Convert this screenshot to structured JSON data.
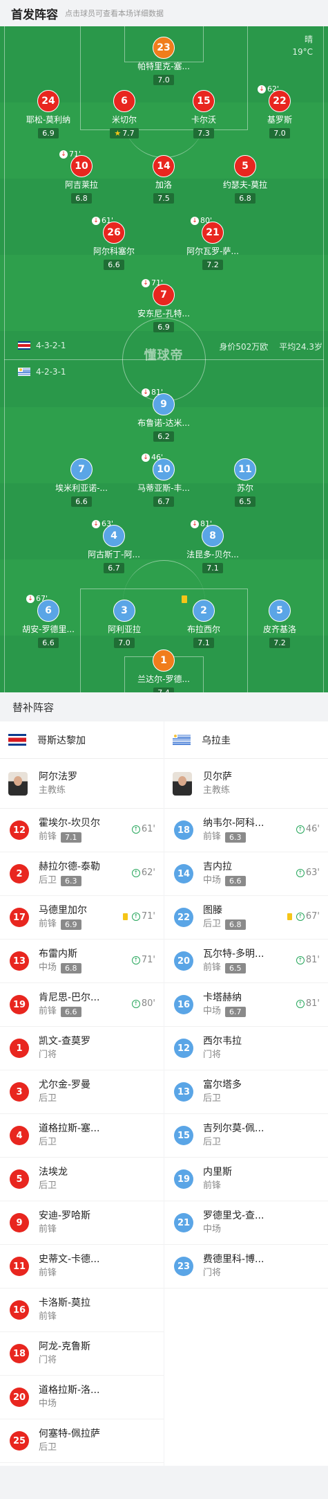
{
  "header": {
    "title": "首发阵容",
    "subtitle": "点击球员可查看本场详细数据"
  },
  "weather": {
    "condition": "晴",
    "temperature": "19°C"
  },
  "pitch": {
    "logo": "懂球帝"
  },
  "home": {
    "formation": "4-3-2-1",
    "value": "身价502万欧",
    "avg_age": "平均24.3岁"
  },
  "away": {
    "formation": "4-2-3-1"
  },
  "home_players": [
    {
      "num": "23",
      "name": "帕特里克-塞...",
      "rating": "7.0",
      "gk": true
    },
    {
      "num": "24",
      "name": "耶松-莫利纳",
      "rating": "6.9"
    },
    {
      "num": "6",
      "name": "米切尔",
      "rating": "7.7",
      "star": true
    },
    {
      "num": "15",
      "name": "卡尔沃",
      "rating": "7.3"
    },
    {
      "num": "22",
      "name": "基罗斯",
      "rating": "7.0",
      "sub": "62'"
    },
    {
      "num": "10",
      "name": "阿吉莱拉",
      "rating": "6.8",
      "sub": "71'"
    },
    {
      "num": "14",
      "name": "加洛",
      "rating": "7.5"
    },
    {
      "num": "5",
      "name": "约瑟夫-莫拉",
      "rating": "6.8"
    },
    {
      "num": "26",
      "name": "阿尔科塞尔",
      "rating": "6.6",
      "sub": "61'"
    },
    {
      "num": "21",
      "name": "阿尔瓦罗-萨...",
      "rating": "7.2",
      "sub": "80'"
    },
    {
      "num": "7",
      "name": "安东尼-孔特...",
      "rating": "6.9",
      "sub": "71'"
    }
  ],
  "away_players": [
    {
      "num": "9",
      "name": "布鲁诺-达米...",
      "rating": "6.2",
      "sub": "81'"
    },
    {
      "num": "7",
      "name": "埃米利亚诺-...",
      "rating": "6.6"
    },
    {
      "num": "10",
      "name": "马蒂亚斯-丰...",
      "rating": "6.7",
      "sub": "46'"
    },
    {
      "num": "11",
      "name": "苏尔",
      "rating": "6.5"
    },
    {
      "num": "4",
      "name": "阿古斯丁-阿...",
      "rating": "6.7",
      "sub": "63'"
    },
    {
      "num": "8",
      "name": "法昆多-贝尔...",
      "rating": "7.1",
      "sub": "81'"
    },
    {
      "num": "6",
      "name": "胡安-罗德里...",
      "rating": "6.6",
      "sub": "67'"
    },
    {
      "num": "3",
      "name": "阿利亚拉",
      "rating": "7.0"
    },
    {
      "num": "2",
      "name": "布拉西尔",
      "rating": "7.1",
      "card": true
    },
    {
      "num": "5",
      "name": "皮齐基洛",
      "rating": "7.2"
    },
    {
      "num": "1",
      "name": "兰达尔-罗德...",
      "rating": "7.4",
      "gk": true
    }
  ],
  "subs_title": "替补阵容",
  "subs_home": {
    "team": "哥斯达黎加",
    "coach": {
      "name": "阿尔法罗",
      "role": "主教练"
    },
    "players": [
      {
        "num": "12",
        "name": "霍埃尔-坎贝尔",
        "pos": "前锋",
        "rating": "7.1",
        "in": "61'"
      },
      {
        "num": "2",
        "name": "赫拉尔德-泰勒",
        "pos": "后卫",
        "rating": "6.3",
        "in": "62'"
      },
      {
        "num": "17",
        "name": "马德里加尔",
        "pos": "前锋",
        "rating": "6.9",
        "in": "71'",
        "card": true
      },
      {
        "num": "13",
        "name": "布雷内斯",
        "pos": "中场",
        "rating": "6.8",
        "in": "71'"
      },
      {
        "num": "19",
        "name": "肯尼思-巴尔...",
        "pos": "前锋",
        "rating": "6.6",
        "in": "80'"
      },
      {
        "num": "1",
        "name": "凯文-查莫罗",
        "pos": "门将"
      },
      {
        "num": "3",
        "name": "尤尔金-罗曼",
        "pos": "后卫"
      },
      {
        "num": "4",
        "name": "道格拉斯-塞...",
        "pos": "后卫"
      },
      {
        "num": "5",
        "name": "法埃龙",
        "pos": "后卫"
      },
      {
        "num": "9",
        "name": "安迪-罗哈斯",
        "pos": "前锋"
      },
      {
        "num": "11",
        "name": "史蒂文-卡德...",
        "pos": "前锋"
      },
      {
        "num": "16",
        "name": "卡洛斯-莫拉",
        "pos": "前锋"
      },
      {
        "num": "18",
        "name": "阿龙-克鲁斯",
        "pos": "门将"
      },
      {
        "num": "20",
        "name": "道格拉斯-洛...",
        "pos": "中场"
      },
      {
        "num": "25",
        "name": "何塞特-佩拉萨",
        "pos": "后卫"
      }
    ]
  },
  "subs_away": {
    "team": "乌拉圭",
    "coach": {
      "name": "贝尔萨",
      "role": "主教练"
    },
    "players": [
      {
        "num": "18",
        "name": "纳韦尔-阿科...",
        "pos": "前锋",
        "rating": "6.3",
        "in": "46'"
      },
      {
        "num": "14",
        "name": "吉内拉",
        "pos": "中场",
        "rating": "6.6",
        "in": "63'"
      },
      {
        "num": "22",
        "name": "图滕",
        "pos": "后卫",
        "rating": "6.8",
        "in": "67'",
        "card": true
      },
      {
        "num": "20",
        "name": "瓦尔特-多明...",
        "pos": "前锋",
        "rating": "6.5",
        "in": "81'"
      },
      {
        "num": "16",
        "name": "卡塔赫纳",
        "pos": "中场",
        "rating": "6.7",
        "in": "81'"
      },
      {
        "num": "12",
        "name": "西尔韦拉",
        "pos": "门将"
      },
      {
        "num": "13",
        "name": "富尔塔多",
        "pos": "后卫"
      },
      {
        "num": "15",
        "name": "吉列尔莫-佩...",
        "pos": "后卫"
      },
      {
        "num": "19",
        "name": "内里斯",
        "pos": "前锋"
      },
      {
        "num": "21",
        "name": "罗德里戈-查...",
        "pos": "中场"
      },
      {
        "num": "23",
        "name": "费德里科-博...",
        "pos": "门将"
      }
    ]
  }
}
